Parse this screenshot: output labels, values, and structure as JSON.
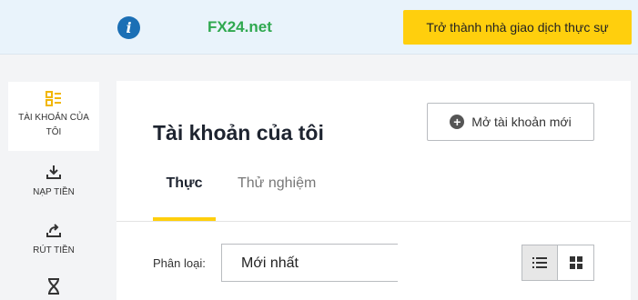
{
  "banner": {
    "icon": "info-icon",
    "icon_glyph": "i",
    "brand": "FX24.net",
    "cta_label": "Trở thành nhà giao dịch thực sự"
  },
  "sidebar": {
    "items": [
      {
        "label_line1": "TÀI KHOẢN CỦA",
        "label_line2": "TÔI",
        "icon": "accounts-icon",
        "active": true
      },
      {
        "label": "NẠP TIỀN",
        "icon": "download-icon"
      },
      {
        "label": "RÚT TIỀN",
        "icon": "upload-share-icon"
      },
      {
        "label": "",
        "icon": "hourglass-icon"
      }
    ]
  },
  "main": {
    "title": "Tài khoản của tôi",
    "open_account_label": "Mở tài khoản mới",
    "tabs": [
      {
        "label": "Thực",
        "active": true
      },
      {
        "label": "Thử nghiệm",
        "active": false
      }
    ],
    "filter": {
      "label": "Phân loại:",
      "value": "Mới nhất"
    },
    "view_modes": [
      "list-view",
      "grid-view"
    ],
    "active_view": "list-view"
  },
  "colors": {
    "accent": "#ffcf0d",
    "brand_green": "#2fa84f",
    "info_blue": "#1b6fb5",
    "banner_bg": "#e9f3fb"
  }
}
